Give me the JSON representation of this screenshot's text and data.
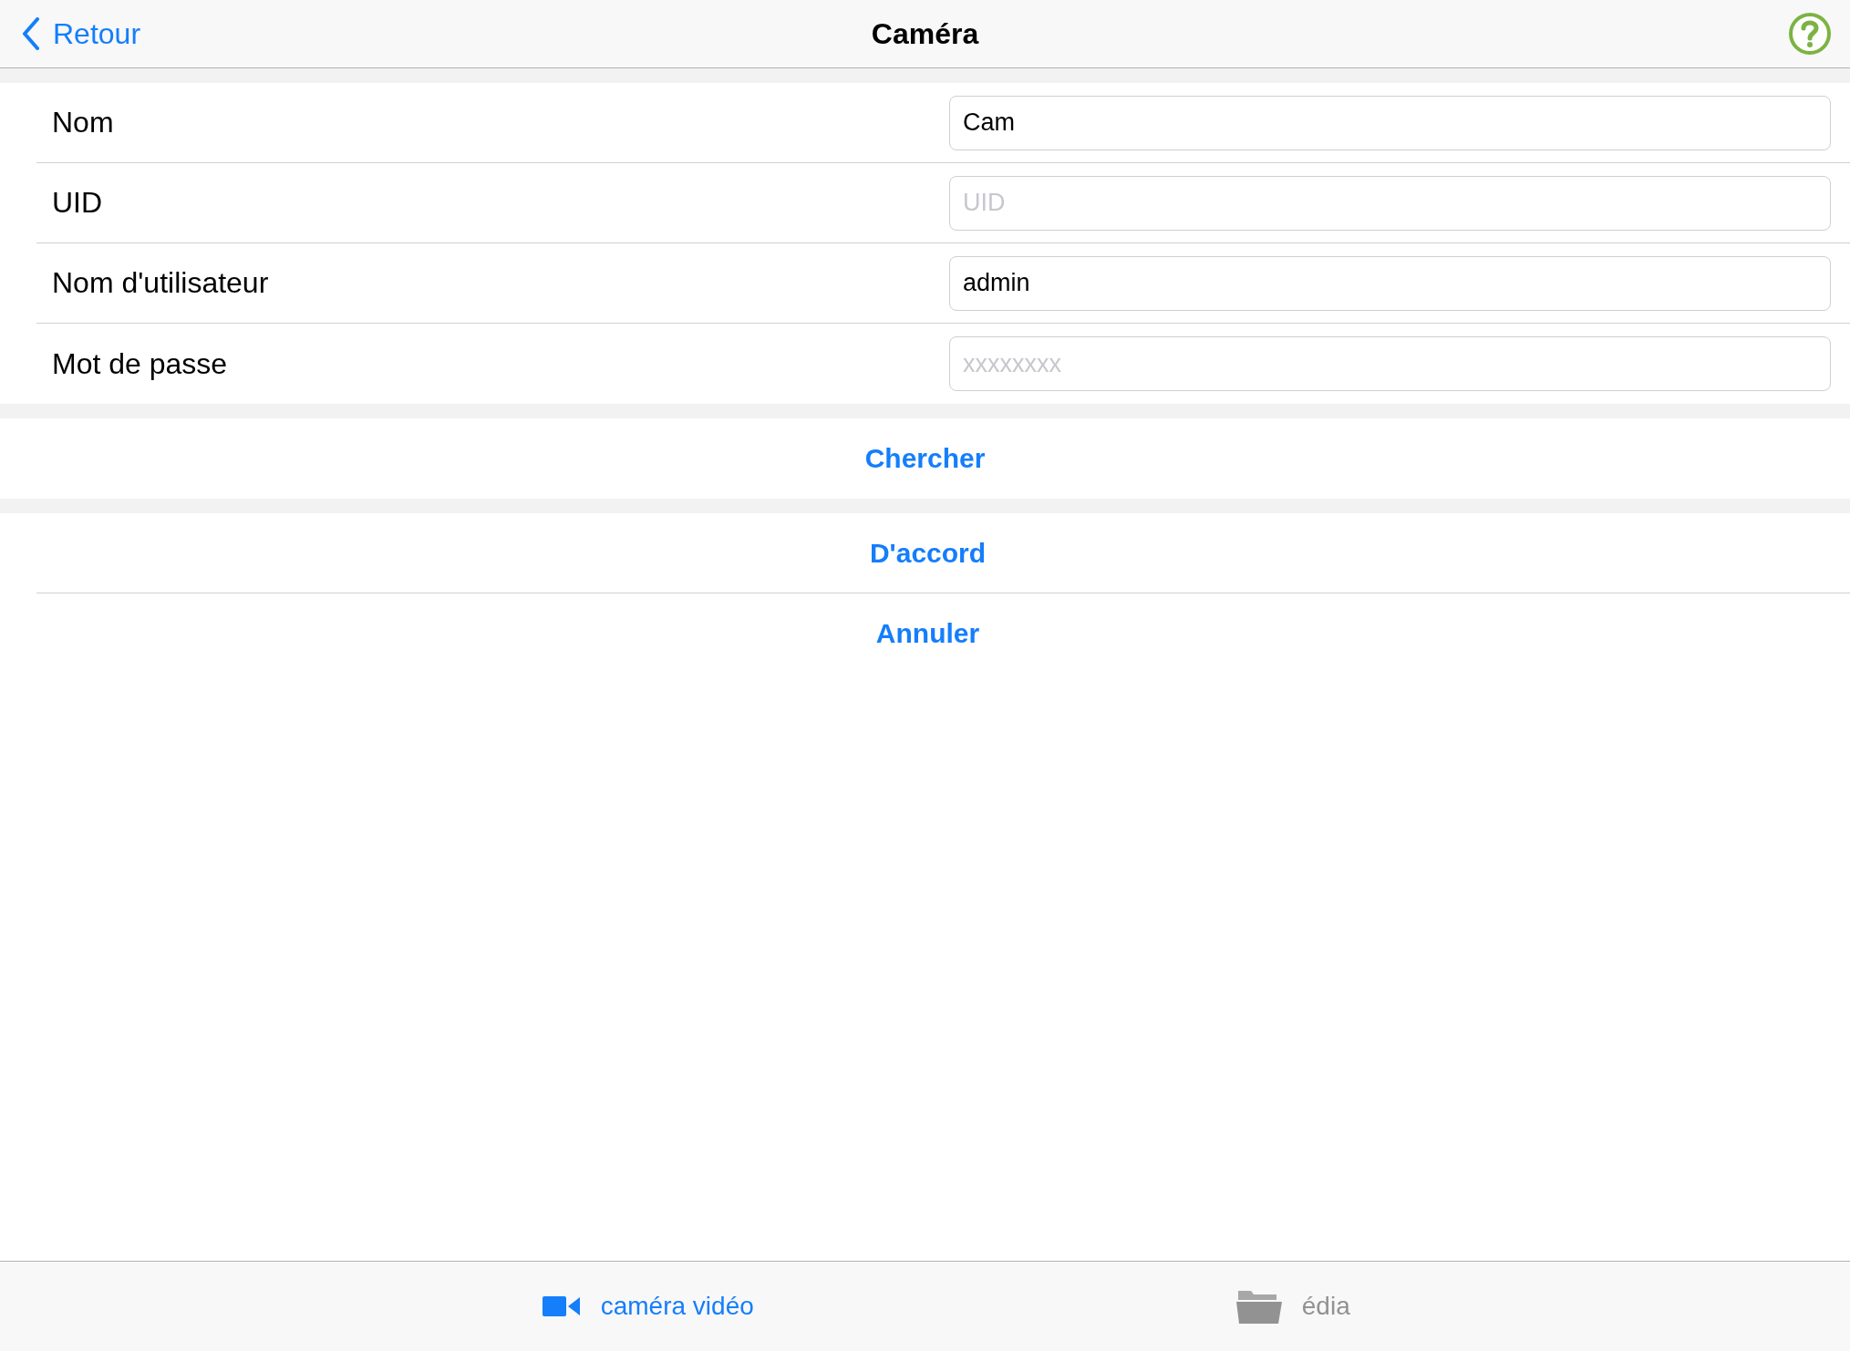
{
  "nav_bar": {
    "back": "Retour",
    "title": "Caméra"
  },
  "form": {
    "rows": [
      {
        "label": "Nom",
        "value": "Cam",
        "placeholder": ""
      },
      {
        "label": "UID",
        "value": "",
        "placeholder": "UID"
      },
      {
        "label": "Nom d'utilisateur",
        "value": "admin",
        "placeholder": ""
      },
      {
        "label": "Mot de passe",
        "value": "",
        "placeholder": "xxxxxxxx"
      }
    ]
  },
  "search_button": "Chercher",
  "actions": [
    "D'accord",
    "Annuler"
  ],
  "tab_bar": [
    {
      "label": "caméra vidéo",
      "kind": "camera",
      "selected": true
    },
    {
      "label": "édia",
      "kind": "folder",
      "selected": false
    }
  ]
}
